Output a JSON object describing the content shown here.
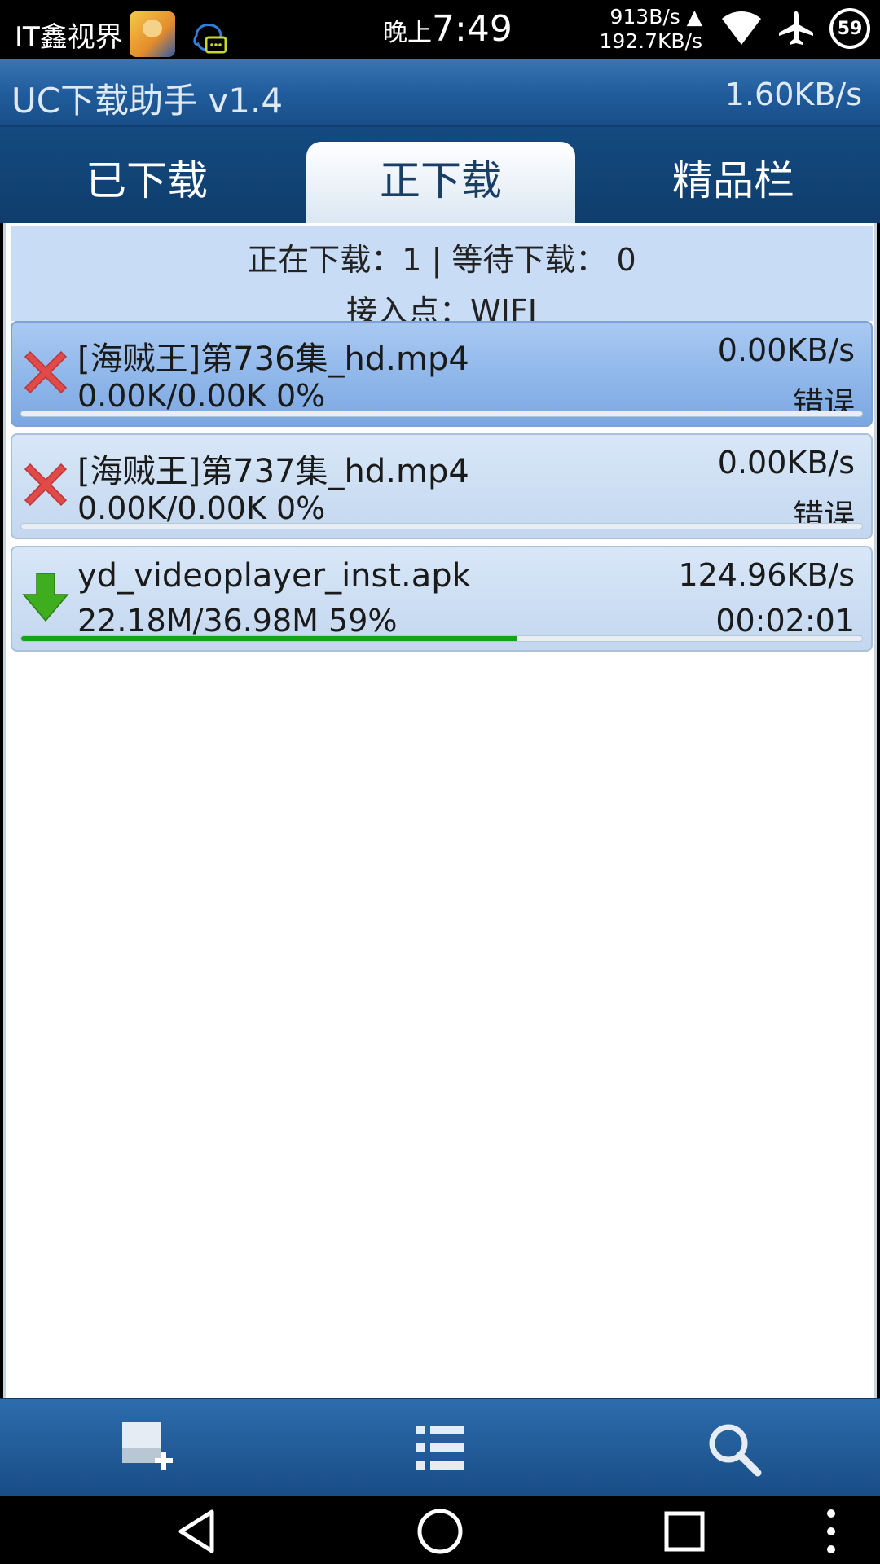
{
  "status_bar": {
    "carrier": "IT鑫视界",
    "time_prefix": "晚上",
    "time": "7:49",
    "up_speed": "913B/s",
    "down_speed": "192.7KB/s",
    "battery": "59",
    "icons": [
      "avatar-icon",
      "qq-icon",
      "wifi-icon",
      "airplane-icon",
      "battery-icon"
    ]
  },
  "app": {
    "title": "UC下载助手 v1.4",
    "total_speed": "1.60KB/s"
  },
  "tabs": [
    {
      "label": "已下载",
      "active": false
    },
    {
      "label": "正下载",
      "active": true
    },
    {
      "label": "精品栏",
      "active": false
    }
  ],
  "summary": {
    "line1": "正在下载：1 | 等待下载： 0",
    "line2": "接入点：WIFI"
  },
  "downloads": [
    {
      "name": "[海贼王]第736集_hd.mp4",
      "size": "0.00K/0.00K  0%",
      "speed": "0.00KB/s",
      "state": "错误",
      "icon": "error-x-icon",
      "progress": 0,
      "selected": true
    },
    {
      "name": "[海贼王]第737集_hd.mp4",
      "size": "0.00K/0.00K  0%",
      "speed": "0.00KB/s",
      "state": "错误",
      "icon": "error-x-icon",
      "progress": 0,
      "selected": false
    },
    {
      "name": "yd_videoplayer_inst.apk",
      "size": "22.18M/36.98M  59%",
      "speed": "124.96KB/s",
      "state": "00:02:01",
      "icon": "download-arrow-icon",
      "progress": 0.59,
      "selected": false
    }
  ],
  "toolbar": {
    "icons": [
      "new-task-icon",
      "list-icon",
      "search-icon"
    ]
  },
  "colors": {
    "progress": "#15a31a",
    "error": "#e24a4a",
    "title_bar": "#1f5b9b"
  }
}
